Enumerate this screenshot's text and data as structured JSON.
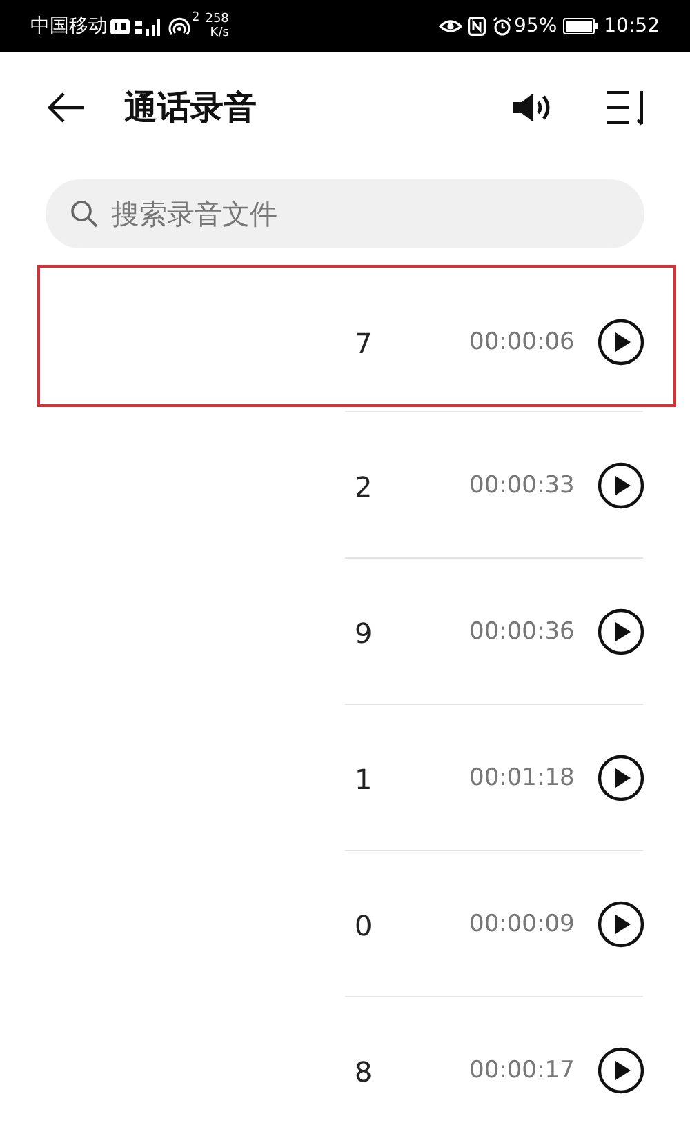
{
  "status_bar": {
    "carrier": "中国移动",
    "hotspot_count": "2",
    "speed": "258",
    "speed_unit": "K/s",
    "battery": "95%",
    "time": "10:52"
  },
  "header": {
    "title": "通话录音"
  },
  "search": {
    "placeholder": "搜索录音文件"
  },
  "recordings": [
    {
      "name_tail": "7",
      "duration": "00:00:06",
      "highlighted": true
    },
    {
      "name_tail": "2",
      "duration": "00:00:33",
      "highlighted": false
    },
    {
      "name_tail": "9",
      "duration": "00:00:36",
      "highlighted": false
    },
    {
      "name_tail": "1",
      "duration": "00:01:18",
      "highlighted": false
    },
    {
      "name_tail": "0",
      "duration": "00:00:09",
      "highlighted": false
    },
    {
      "name_tail": "8",
      "duration": "00:00:17",
      "highlighted": false
    }
  ]
}
